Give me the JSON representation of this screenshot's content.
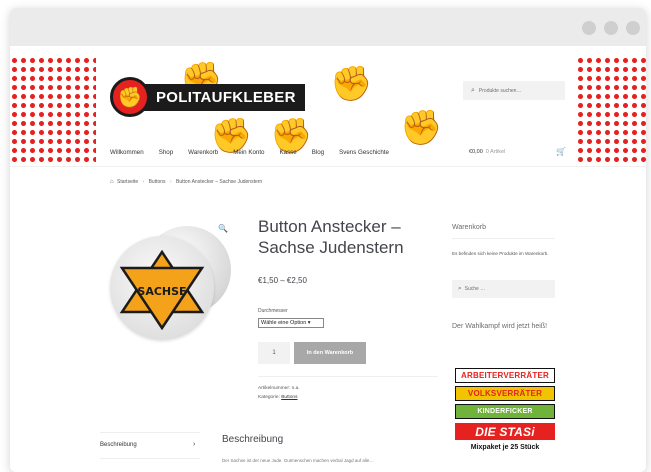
{
  "window": {
    "controls": [
      "window-control-1",
      "window-control-2",
      "window-control-3"
    ]
  },
  "header": {
    "logo_text": "POLITAUFKLEBER",
    "logo_icon": "raised-fist-icon",
    "search_placeholder": "Produkte suchen…",
    "nav": [
      "Willkommen",
      "Shop",
      "Warenkorb",
      "Mein Konto",
      "Kasse",
      "Blog",
      "Svens Geschichte"
    ],
    "cart_total": "€0,00",
    "cart_count": "0 Artikel",
    "colors": {
      "accent_red": "#e5221f",
      "logo_dark": "#1b1b1b"
    }
  },
  "breadcrumb": [
    "Startseite",
    "Buttons",
    "Button Anstecker – Sachse Judenstern"
  ],
  "product": {
    "title": "Button Anstecker – Sachse Judenstern",
    "price": "€1,50 – €2,50",
    "variation_label": "Durchmesser",
    "variation_selected": "Wähle eine Option",
    "quantity": "1",
    "add_to_cart": "In den Warenkorb",
    "sku_line": "Artikelnummer: n.a.",
    "category_label": "Kategorie:",
    "category_value": "Buttons",
    "image_text": "SACHSE"
  },
  "sidebar": {
    "cart_heading": "Warenkorb",
    "cart_empty": "Es befinden sich keine Produkte im Warenkorb.",
    "search_placeholder": "Suche …",
    "promo_text": "Der Wahlkampf wird jetzt heiß!",
    "banner_lines": [
      "ARBEITERVERRÄTER",
      "VOLKSVERRÄTER",
      "KINDERFICKER",
      "DIE STASi"
    ],
    "banner_footer": "Mixpaket je 25 Stück"
  },
  "tabs": {
    "items": [
      "Beschreibung"
    ],
    "heading": "Beschreibung",
    "text_start": "Der Sachse ist der neue Jude. Gutmenschen machen verbal Jagd auf alle…"
  }
}
